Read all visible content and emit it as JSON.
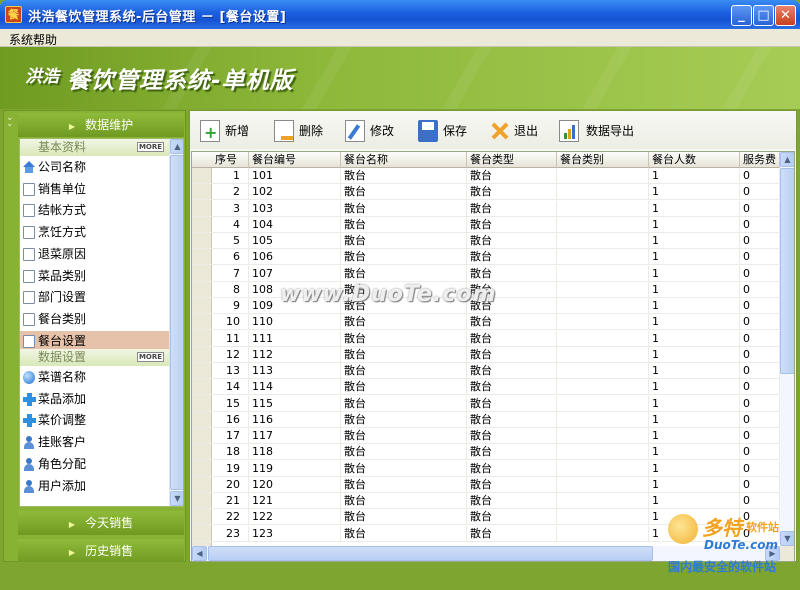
{
  "window": {
    "title": "洪浩餐饮管理系统-后台管理 － [餐台设置]",
    "icon": "app-icon",
    "controls": {
      "minimize": "_",
      "maximize": "□",
      "close": "✕"
    }
  },
  "menu": {
    "help": "系统帮助"
  },
  "banner": {
    "brand_small": "洪浩",
    "brand_large": "餐饮管理系统-单机版"
  },
  "sidebar": {
    "header_top": "数据维护",
    "group_basic": {
      "label": "基本资料",
      "more": "MORE"
    },
    "group_data": {
      "label": "数据设置",
      "more": "MORE"
    },
    "basic_items": [
      {
        "label": "公司名称",
        "icon": "house-icon"
      },
      {
        "label": "销售单位",
        "icon": "document-icon"
      },
      {
        "label": "结帐方式",
        "icon": "document-icon"
      },
      {
        "label": "烹饪方式",
        "icon": "document-icon"
      },
      {
        "label": "退菜原因",
        "icon": "document-icon"
      },
      {
        "label": "菜品类别",
        "icon": "document-icon"
      },
      {
        "label": "部门设置",
        "icon": "document-icon"
      },
      {
        "label": "餐台类别",
        "icon": "document-icon"
      },
      {
        "label": "餐台设置",
        "icon": "document-icon",
        "selected": true
      }
    ],
    "data_items": [
      {
        "label": "菜谱名称",
        "icon": "globe-icon"
      },
      {
        "label": "菜品添加",
        "icon": "plus-icon"
      },
      {
        "label": "菜价调整",
        "icon": "plus-icon"
      },
      {
        "label": "挂账客户",
        "icon": "user-icon"
      },
      {
        "label": "角色分配",
        "icon": "user-icon"
      },
      {
        "label": "用户添加",
        "icon": "user-icon"
      }
    ],
    "header_today": "今天销售",
    "header_history": "历史销售"
  },
  "toolbar": {
    "new": "新增",
    "delete": "删除",
    "edit": "修改",
    "save": "保存",
    "exit": "退出",
    "export": "数据导出"
  },
  "grid": {
    "columns": [
      "序号",
      "餐台编号",
      "餐台名称",
      "餐台类型",
      "餐台类别",
      "餐台人数",
      "服务费"
    ],
    "rows": [
      [
        "1",
        "101",
        "散台",
        "散台",
        "",
        "1",
        "0"
      ],
      [
        "2",
        "102",
        "散台",
        "散台",
        "",
        "1",
        "0"
      ],
      [
        "3",
        "103",
        "散台",
        "散台",
        "",
        "1",
        "0"
      ],
      [
        "4",
        "104",
        "散台",
        "散台",
        "",
        "1",
        "0"
      ],
      [
        "5",
        "105",
        "散台",
        "散台",
        "",
        "1",
        "0"
      ],
      [
        "6",
        "106",
        "散台",
        "散台",
        "",
        "1",
        "0"
      ],
      [
        "7",
        "107",
        "散台",
        "散台",
        "",
        "1",
        "0"
      ],
      [
        "8",
        "108",
        "散台",
        "散台",
        "",
        "1",
        "0"
      ],
      [
        "9",
        "109",
        "散台",
        "散台",
        "",
        "1",
        "0"
      ],
      [
        "10",
        "110",
        "散台",
        "散台",
        "",
        "1",
        "0"
      ],
      [
        "11",
        "111",
        "散台",
        "散台",
        "",
        "1",
        "0"
      ],
      [
        "12",
        "112",
        "散台",
        "散台",
        "",
        "1",
        "0"
      ],
      [
        "13",
        "113",
        "散台",
        "散台",
        "",
        "1",
        "0"
      ],
      [
        "14",
        "114",
        "散台",
        "散台",
        "",
        "1",
        "0"
      ],
      [
        "15",
        "115",
        "散台",
        "散台",
        "",
        "1",
        "0"
      ],
      [
        "16",
        "116",
        "散台",
        "散台",
        "",
        "1",
        "0"
      ],
      [
        "17",
        "117",
        "散台",
        "散台",
        "",
        "1",
        "0"
      ],
      [
        "18",
        "118",
        "散台",
        "散台",
        "",
        "1",
        "0"
      ],
      [
        "19",
        "119",
        "散台",
        "散台",
        "",
        "1",
        "0"
      ],
      [
        "20",
        "120",
        "散台",
        "散台",
        "",
        "1",
        "0"
      ],
      [
        "21",
        "121",
        "散台",
        "散台",
        "",
        "1",
        "0"
      ],
      [
        "22",
        "122",
        "散台",
        "散台",
        "",
        "1",
        "0"
      ],
      [
        "23",
        "123",
        "散台",
        "散台",
        "",
        "1",
        "0"
      ]
    ]
  },
  "watermarks": {
    "center": "www.DuoTe.com",
    "logo_cn": "多特",
    "logo_soft": "软件站",
    "logo_domain": "DuoTe.com",
    "logo_slogan": "国内最安全的软件站"
  }
}
